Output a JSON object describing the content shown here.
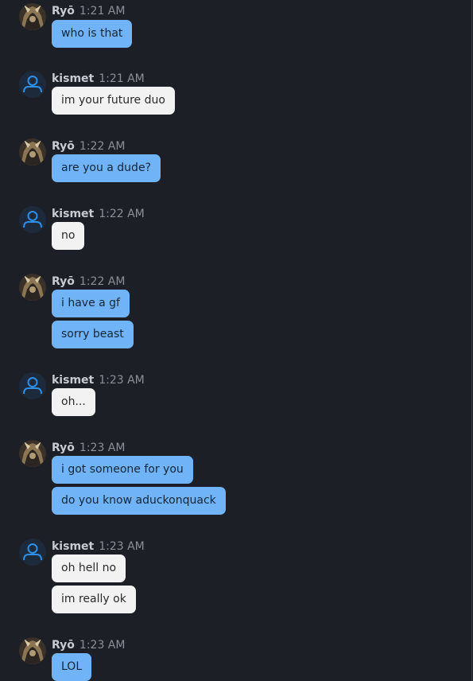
{
  "messages": [
    {
      "author": "Ryō",
      "time": "1:21 AM",
      "side": "self",
      "lines": [
        "who is that"
      ]
    },
    {
      "author": "kismet",
      "time": "1:21 AM",
      "side": "other",
      "lines": [
        "im your future duo"
      ]
    },
    {
      "author": "Ryō",
      "time": "1:22 AM",
      "side": "self",
      "lines": [
        "are you a dude?"
      ]
    },
    {
      "author": "kismet",
      "time": "1:22 AM",
      "side": "other",
      "lines": [
        "no"
      ]
    },
    {
      "author": "Ryō",
      "time": "1:22 AM",
      "side": "self",
      "lines": [
        "i have a gf",
        "sorry beast"
      ]
    },
    {
      "author": "kismet",
      "time": "1:23 AM",
      "side": "other",
      "lines": [
        "oh..."
      ]
    },
    {
      "author": "Ryō",
      "time": "1:23 AM",
      "side": "self",
      "lines": [
        "i got someone for you",
        "do you know aduckonquack"
      ]
    },
    {
      "author": "kismet",
      "time": "1:23 AM",
      "side": "other",
      "lines": [
        "oh hell no",
        "im really ok"
      ]
    },
    {
      "author": "Ryō",
      "time": "1:23 AM",
      "side": "self",
      "lines": [
        "LOL"
      ]
    }
  ],
  "colors": {
    "background": "#1c1f26",
    "self_bubble": "#70b4f7",
    "other_bubble": "#f2f2f2",
    "user_icon": "#2d8fe6"
  },
  "icons": {
    "self_avatar": "character-avatar-icon",
    "other_avatar": "default-user-icon"
  }
}
